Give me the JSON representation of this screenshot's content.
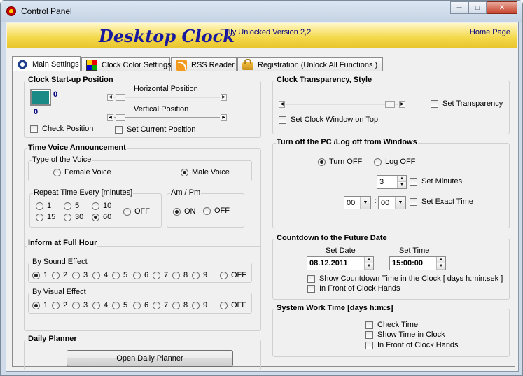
{
  "window": {
    "title": "Control Panel",
    "controls": [
      "minimize",
      "maximize",
      "close"
    ]
  },
  "banner": {
    "brand": "Desktop Clock",
    "version": "Fully Unlocked Version 2,2",
    "home_link": "Home Page"
  },
  "tabs": [
    {
      "label": "Main Settings",
      "icon": "gear-icon",
      "active": true
    },
    {
      "label": "Clock Color Settings",
      "icon": "palette-icon",
      "active": false
    },
    {
      "label": "RSS Reader",
      "icon": "rss-icon",
      "active": false
    },
    {
      "label": "Registration   (Unlock All Functions )",
      "icon": "lock-icon",
      "active": false
    }
  ],
  "startup": {
    "title": "Clock Start-up Position",
    "x_value": "0",
    "y_value": "0",
    "horizontal_label": "Horizontal Position",
    "vertical_label": "Vertical Position",
    "check_position": "Check Position",
    "set_current": "Set Current Position"
  },
  "voice": {
    "title": "Time Voice Announcement",
    "type_title": "Type of the Voice",
    "female": "Female Voice",
    "male": "Male Voice",
    "repeat_title": "Repeat Time Every  [minutes]",
    "repeat_options": [
      "1",
      "5",
      "10",
      "15",
      "30",
      "60",
      "OFF"
    ],
    "repeat_selected": "60",
    "ampm_title": "Am / Pm",
    "on": "ON",
    "off": "OFF",
    "ampm_selected": "ON"
  },
  "full_hour": {
    "title": "Inform at Full Hour",
    "sound_title": "By Sound Effect",
    "visual_title": "By Visual Effect",
    "options": [
      "1",
      "2",
      "3",
      "4",
      "5",
      "6",
      "7",
      "8",
      "9",
      "OFF"
    ],
    "sound_selected": "1",
    "visual_selected": "1"
  },
  "planner": {
    "title": "Daily Planner",
    "button": "Open Daily Planner"
  },
  "transparency": {
    "title": "Clock Transparency, Style",
    "set_transparency": "Set Transparency",
    "on_top": "Set Clock Window on Top"
  },
  "shutdown": {
    "title": "Turn off the PC /Log off from Windows",
    "turn_off": "Turn OFF",
    "log_off": "Log OFF",
    "selected": "Turn OFF",
    "minutes_value": "3",
    "set_minutes": "Set Minutes",
    "hour": "00",
    "separator": ":",
    "minute": "00",
    "set_exact": "Set Exact Time"
  },
  "countdown": {
    "title": "Countdown to the Future Date",
    "set_date_label": "Set Date",
    "set_time_label": "Set Time",
    "date": "08.12.2011",
    "time": "15:00:00",
    "show_in_clock": "Show Countdown Time in the Clock  [ days  h:min:sek ]",
    "in_front": "In Front of Clock Hands"
  },
  "work_time": {
    "title": "System Work Time [days h:m:s]",
    "check_time": "Check Time",
    "show_time": "Show Time in Clock",
    "in_front": "In Front of Clock Hands"
  }
}
